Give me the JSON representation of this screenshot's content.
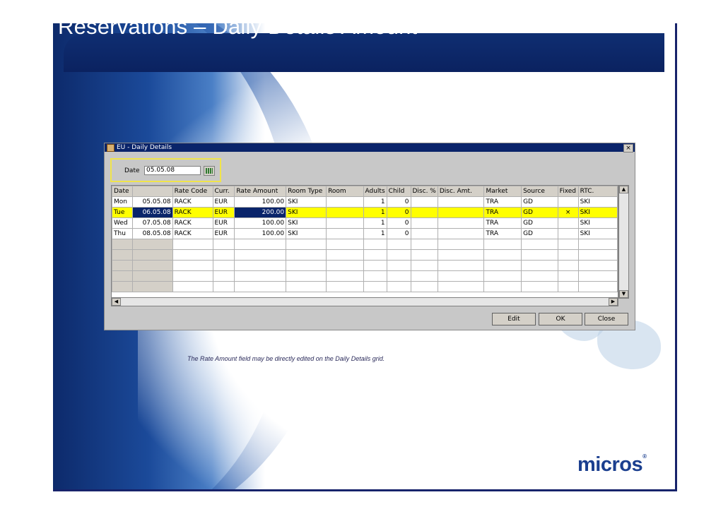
{
  "slide": {
    "title": "Reservations – Daily Details Amount",
    "caption": "The Rate Amount field may be directly edited on the Daily Details grid.",
    "logo": "micros"
  },
  "window": {
    "title": "EU - Daily Details",
    "close_glyph": "×",
    "date_label": "Date",
    "date_value": "05.05.08",
    "columns": [
      "Date",
      "",
      "Rate Code",
      "Curr.",
      "Rate Amount",
      "Room Type",
      "Room",
      "Adults",
      "Child",
      "Disc. %",
      "Disc. Amt.",
      "Market",
      "Source",
      "Fixed",
      "RTC."
    ],
    "rows": [
      {
        "day": "Mon",
        "date": "05.05.08",
        "rate_code": "RACK",
        "curr": "EUR",
        "amount": "100.00",
        "room_type": "SKI",
        "room": "",
        "adults": "1",
        "child": "0",
        "disc_pct": "",
        "disc_amt": "",
        "market": "TRA",
        "source": "GD",
        "fixed": "",
        "rtc": "SKI",
        "selected": false
      },
      {
        "day": "Tue",
        "date": "06.05.08",
        "rate_code": "RACK",
        "curr": "EUR",
        "amount": "200.00",
        "room_type": "SKI",
        "room": "",
        "adults": "1",
        "child": "0",
        "disc_pct": "",
        "disc_amt": "",
        "market": "TRA",
        "source": "GD",
        "fixed": "×",
        "rtc": "SKI",
        "selected": true
      },
      {
        "day": "Wed",
        "date": "07.05.08",
        "rate_code": "RACK",
        "curr": "EUR",
        "amount": "100.00",
        "room_type": "SKI",
        "room": "",
        "adults": "1",
        "child": "0",
        "disc_pct": "",
        "disc_amt": "",
        "market": "TRA",
        "source": "GD",
        "fixed": "",
        "rtc": "SKI",
        "selected": false
      },
      {
        "day": "Thu",
        "date": "08.05.08",
        "rate_code": "RACK",
        "curr": "EUR",
        "amount": "100.00",
        "room_type": "SKI",
        "room": "",
        "adults": "1",
        "child": "0",
        "disc_pct": "",
        "disc_amt": "",
        "market": "TRA",
        "source": "GD",
        "fixed": "",
        "rtc": "SKI",
        "selected": false
      }
    ],
    "empty_rows": 5,
    "buttons": {
      "edit": "Edit",
      "ok": "OK",
      "close": "Close"
    },
    "colors": {
      "highlight": "#ffff00",
      "selection": "#0a246a"
    }
  }
}
